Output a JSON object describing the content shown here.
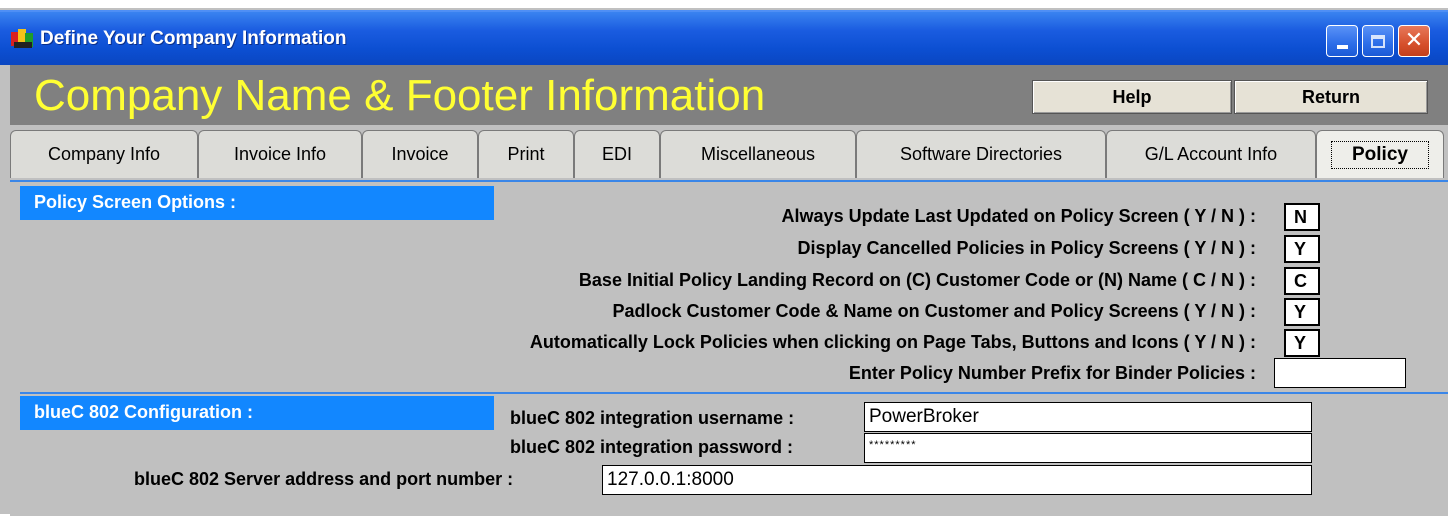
{
  "window": {
    "title": "Define Your Company Information",
    "icon": "app-icon",
    "controls": {
      "minimize": "minimize-icon",
      "maximize": "maximize-icon",
      "close": "close-icon"
    }
  },
  "header": {
    "heading": "Company Name & Footer Information",
    "help_label": "Help",
    "return_label": "Return"
  },
  "tabs": [
    {
      "label": "Company Info"
    },
    {
      "label": "Invoice Info"
    },
    {
      "label": "Invoice"
    },
    {
      "label": "Print"
    },
    {
      "label": "EDI"
    },
    {
      "label": "Miscellaneous"
    },
    {
      "label": "Software Directories"
    },
    {
      "label": "G/L Account Info"
    },
    {
      "label": "Policy",
      "active": true
    }
  ],
  "policy_section": {
    "title": "Policy Screen Options :",
    "options": [
      {
        "label": "Always Update Last Updated on Policy Screen ( Y / N ) :",
        "value": "N"
      },
      {
        "label": "Display Cancelled Policies in Policy Screens ( Y / N ) :",
        "value": "Y"
      },
      {
        "label": "Base Initial Policy Landing Record on (C) Customer Code or (N) Name  ( C / N ) :",
        "value": "C"
      },
      {
        "label": "Padlock Customer Code & Name on Customer and Policy Screens ( Y / N ) :",
        "value": "Y"
      },
      {
        "label": "Automatically Lock Policies when clicking on Page Tabs, Buttons and Icons ( Y / N ) :",
        "value": "Y"
      }
    ],
    "prefix_label": "Enter Policy Number Prefix for Binder Policies  :",
    "prefix_value": ""
  },
  "bluec_section": {
    "title": "blueC 802 Configuration :",
    "username_label": "blueC 802 integration username :",
    "username_value": "PowerBroker",
    "password_label": "blueC 802 integration password :",
    "password_value": "*********",
    "server_label": "blueC 802 Server address and port number :",
    "server_value": "127.0.0.1:8000"
  },
  "colors": {
    "title_bar": "#0c4fd2",
    "heading_text": "#ffff33",
    "section_header": "#1287ff",
    "panel_bg": "#c0c0c0"
  }
}
